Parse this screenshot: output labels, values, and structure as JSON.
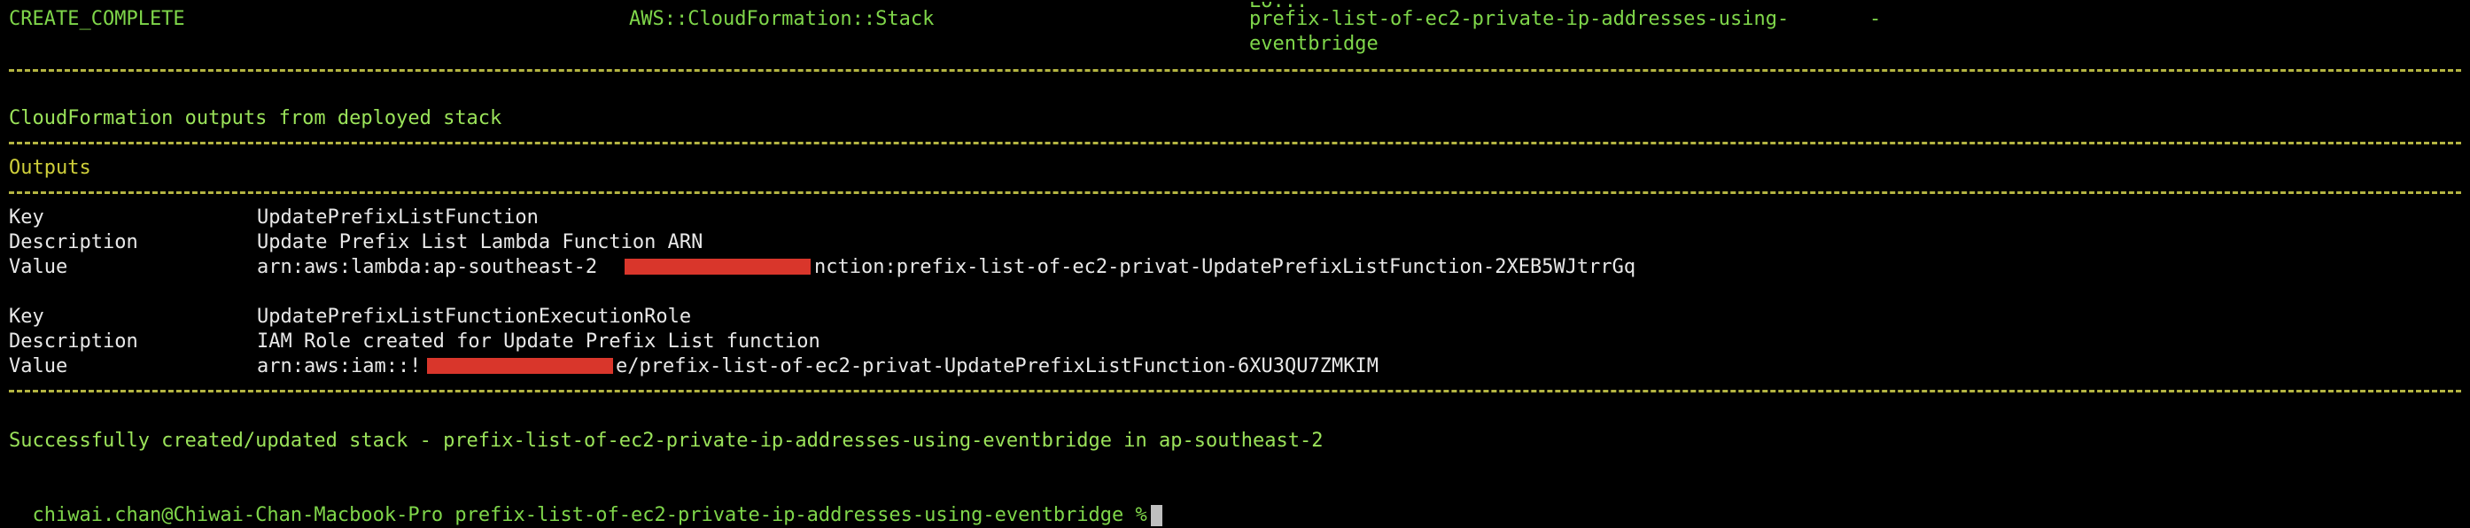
{
  "stack_table_row": {
    "status": "CREATE_COMPLETE",
    "resource_type": "AWS::CloudFormation::Stack",
    "logical_id_cut": "Lo...",
    "logical_id_line1": "prefix-list-of-ec2-private-ip-addresses-using-",
    "logical_id_line2": "eventbridge",
    "replacement": "-"
  },
  "outputs_header": "CloudFormation outputs from deployed stack",
  "outputs_title": "Outputs",
  "outputs": [
    {
      "key_label": "Key",
      "key_value": "UpdatePrefixListFunction",
      "desc_label": "Description",
      "desc_value": "Update Prefix List Lambda Function ARN",
      "value_label": "Value",
      "value_prefix": "arn:aws:lambda:ap-southeast-2",
      "value_suffix": "nction:prefix-list-of-ec2-privat-UpdatePrefixListFunction-2XEB5WJtrrGq"
    },
    {
      "key_label": "Key",
      "key_value": "UpdatePrefixListFunctionExecutionRole",
      "desc_label": "Description",
      "desc_value": "IAM Role created for Update Prefix List function",
      "value_label": "Value",
      "value_prefix": "arn:aws:iam::!",
      "value_suffix": "e/prefix-list-of-ec2-privat-UpdatePrefixListFunction-6XU3QU7ZMKIM"
    }
  ],
  "success_message": "Successfully created/updated stack - prefix-list-of-ec2-private-ip-addresses-using-eventbridge in ap-southeast-2",
  "prompt": "chiwai.chan@Chiwai-Chan-Macbook-Pro prefix-list-of-ec2-private-ip-addresses-using-eventbridge %",
  "colors": {
    "background": "#000000",
    "green": "#7fd64a",
    "yellow": "#cfcf3a",
    "redaction": "#d9362b"
  }
}
